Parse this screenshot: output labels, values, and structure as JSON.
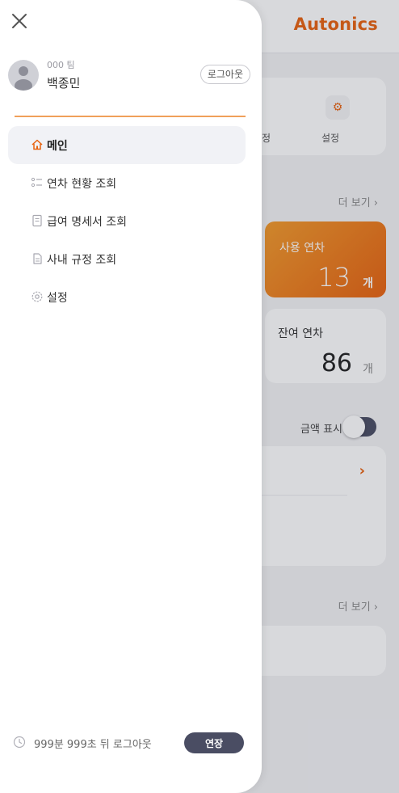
{
  "background": {
    "brand": "Autonics",
    "menu_tiles": [
      "정",
      "설정"
    ],
    "more_label": "더 보기",
    "used_leave": {
      "title": "사용 연차",
      "value": "13",
      "unit": "개"
    },
    "remaining_leave": {
      "title": "잔여 연차",
      "value": "86",
      "unit": "개"
    },
    "amount_toggle_label": "금액 표시",
    "pay_arrow": "›"
  },
  "drawer": {
    "close_icon": "close-icon",
    "profile": {
      "team": "000 팀",
      "name": "백종민",
      "logout_label": "로그아웃"
    },
    "nav": [
      {
        "label": "메인",
        "icon": "home-icon",
        "active": true
      },
      {
        "label": "연차 현황 조회",
        "icon": "list-icon",
        "active": false
      },
      {
        "label": "급여 명세서 조회",
        "icon": "document-icon",
        "active": false
      },
      {
        "label": "사내 규정 조회",
        "icon": "file-icon",
        "active": false
      },
      {
        "label": "설정",
        "icon": "gear-icon",
        "active": false
      }
    ],
    "session": {
      "text": "999분 999초 뒤 로그아웃",
      "extend_label": "연장"
    }
  },
  "colors": {
    "accent": "#e8620f",
    "button_dark": "#4a4d63",
    "divider": "#f0a05a"
  }
}
